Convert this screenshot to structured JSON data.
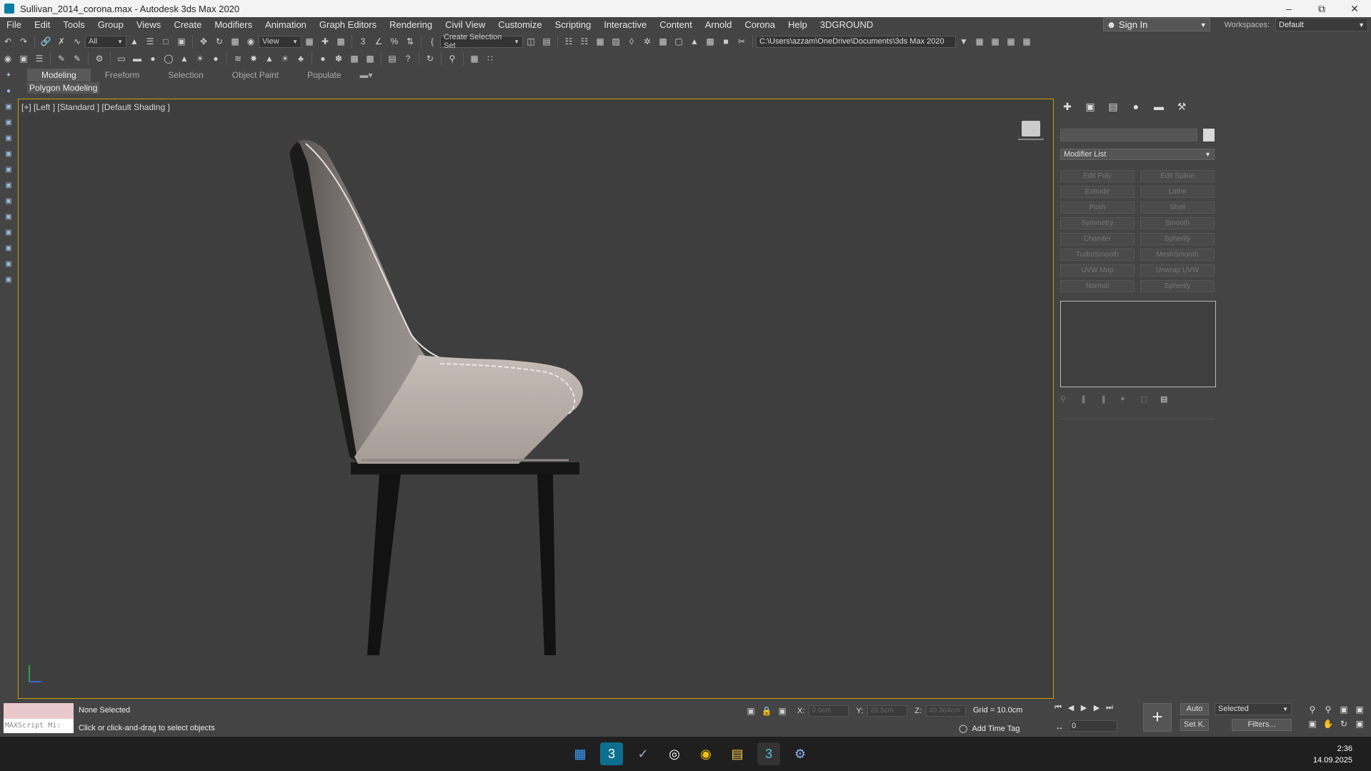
{
  "window": {
    "title": "Sullivan_2014_corona.max - Autodesk 3ds Max 2020",
    "minimize": "–",
    "maximize": "⧉",
    "close": "✕"
  },
  "menu": {
    "items": [
      "File",
      "Edit",
      "Tools",
      "Group",
      "Views",
      "Create",
      "Modifiers",
      "Animation",
      "Graph Editors",
      "Rendering",
      "Civil View",
      "Customize",
      "Scripting",
      "Interactive",
      "Content",
      "Arnold",
      "Corona",
      "Help",
      "3DGROUND"
    ],
    "signin": "Sign In",
    "workspaces_label": "Workspaces:",
    "workspace_value": "Default"
  },
  "toolbar": {
    "selection_filter": "All",
    "ref_coord": "View",
    "selection_set": "Create Selection Set",
    "project_path": "C:\\Users\\azzam\\OneDrive\\Documents\\3ds Max 2020"
  },
  "ribbon": {
    "tabs": [
      "Modeling",
      "Freeform",
      "Selection",
      "Object Paint",
      "Populate"
    ],
    "active_tab": "Modeling",
    "sub_label": "Polygon Modeling"
  },
  "viewport": {
    "label": "[+] [Left ] [Standard ] [Default Shading ]"
  },
  "command_panel": {
    "modifier_list_label": "Modifier List",
    "modifier_buttons": [
      "Edit Poly",
      "Edit Spline",
      "Extrude",
      "Lathe",
      "Push",
      "Shell",
      "Symmetry",
      "Smooth",
      "Chamfer",
      "Spherify",
      "TurboSmooth",
      "MeshSmooth",
      "UVW Map",
      "Unwrap UVW",
      "Normal",
      "Spherify"
    ]
  },
  "status": {
    "maxscript_label": "MAXScript Mi:",
    "selection": "None Selected",
    "prompt": "Click or click-and-drag to select objects",
    "x_label": "X:",
    "x_value": "0.0cm",
    "y_label": "Y:",
    "y_value": "29.5cm",
    "z_label": "Z:",
    "z_value": "40.364cm",
    "grid": "Grid = 10.0cm",
    "add_time_tag": "Add Time Tag",
    "frame": "0",
    "auto_key": "Auto",
    "set_key": "Set K.",
    "key_filter": "Selected",
    "filters": "Filters..."
  },
  "taskbar": {
    "time": "2:36",
    "date": "14.09.2025"
  },
  "colors": {
    "viewport_border": "#c8a100",
    "background": "#444444",
    "taskbar": "#1f1f1f"
  }
}
